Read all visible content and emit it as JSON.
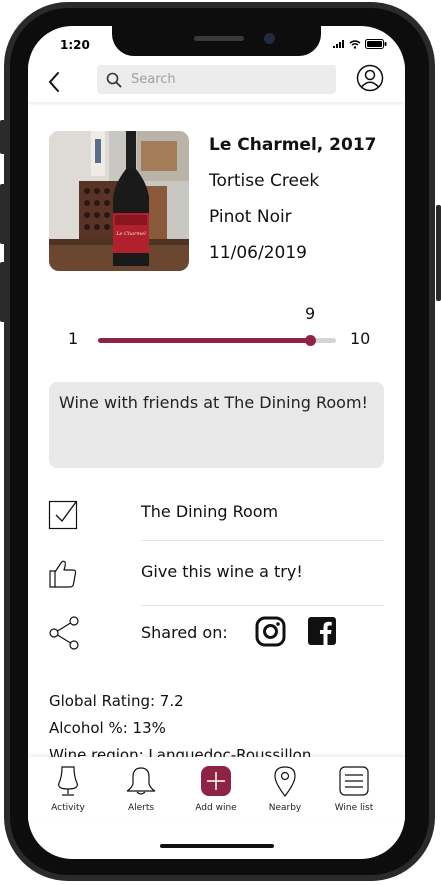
{
  "status": {
    "time": "1:20"
  },
  "search": {
    "placeholder": "Search"
  },
  "wine": {
    "name": "Le Charmel, 2017",
    "producer": "Tortise Creek",
    "varietal": "Pinot Noir",
    "date": "11/06/2019"
  },
  "rating": {
    "min": "1",
    "max": "10",
    "value": "9",
    "fraction": 0.89
  },
  "note": "Wine with friends at The Dining Room!",
  "rows": {
    "location": "The Dining Room",
    "recommend": "Give this wine a try!",
    "shared_label": "Shared on:"
  },
  "details": {
    "global_rating": "Global Rating: 7.2",
    "alcohol": "Alcohol %: 13%",
    "region": "Wine region: Languedoc-Roussillon"
  },
  "nav": {
    "activity": "Activity",
    "alerts": "Alerts",
    "add_wine": "Add wine",
    "nearby": "Nearby",
    "wine_list": "Wine list"
  },
  "colors": {
    "accent": "#8e2345",
    "track": "#d4d4d4",
    "note_bg": "#e9e9e9"
  },
  "icons": {
    "back": "chevron-left-icon",
    "search": "search-icon",
    "profile": "user-circle-icon",
    "location": "checkbox-icon",
    "recommend": "thumbs-up-icon",
    "share": "share-icon",
    "instagram": "instagram-icon",
    "facebook": "facebook-icon"
  }
}
